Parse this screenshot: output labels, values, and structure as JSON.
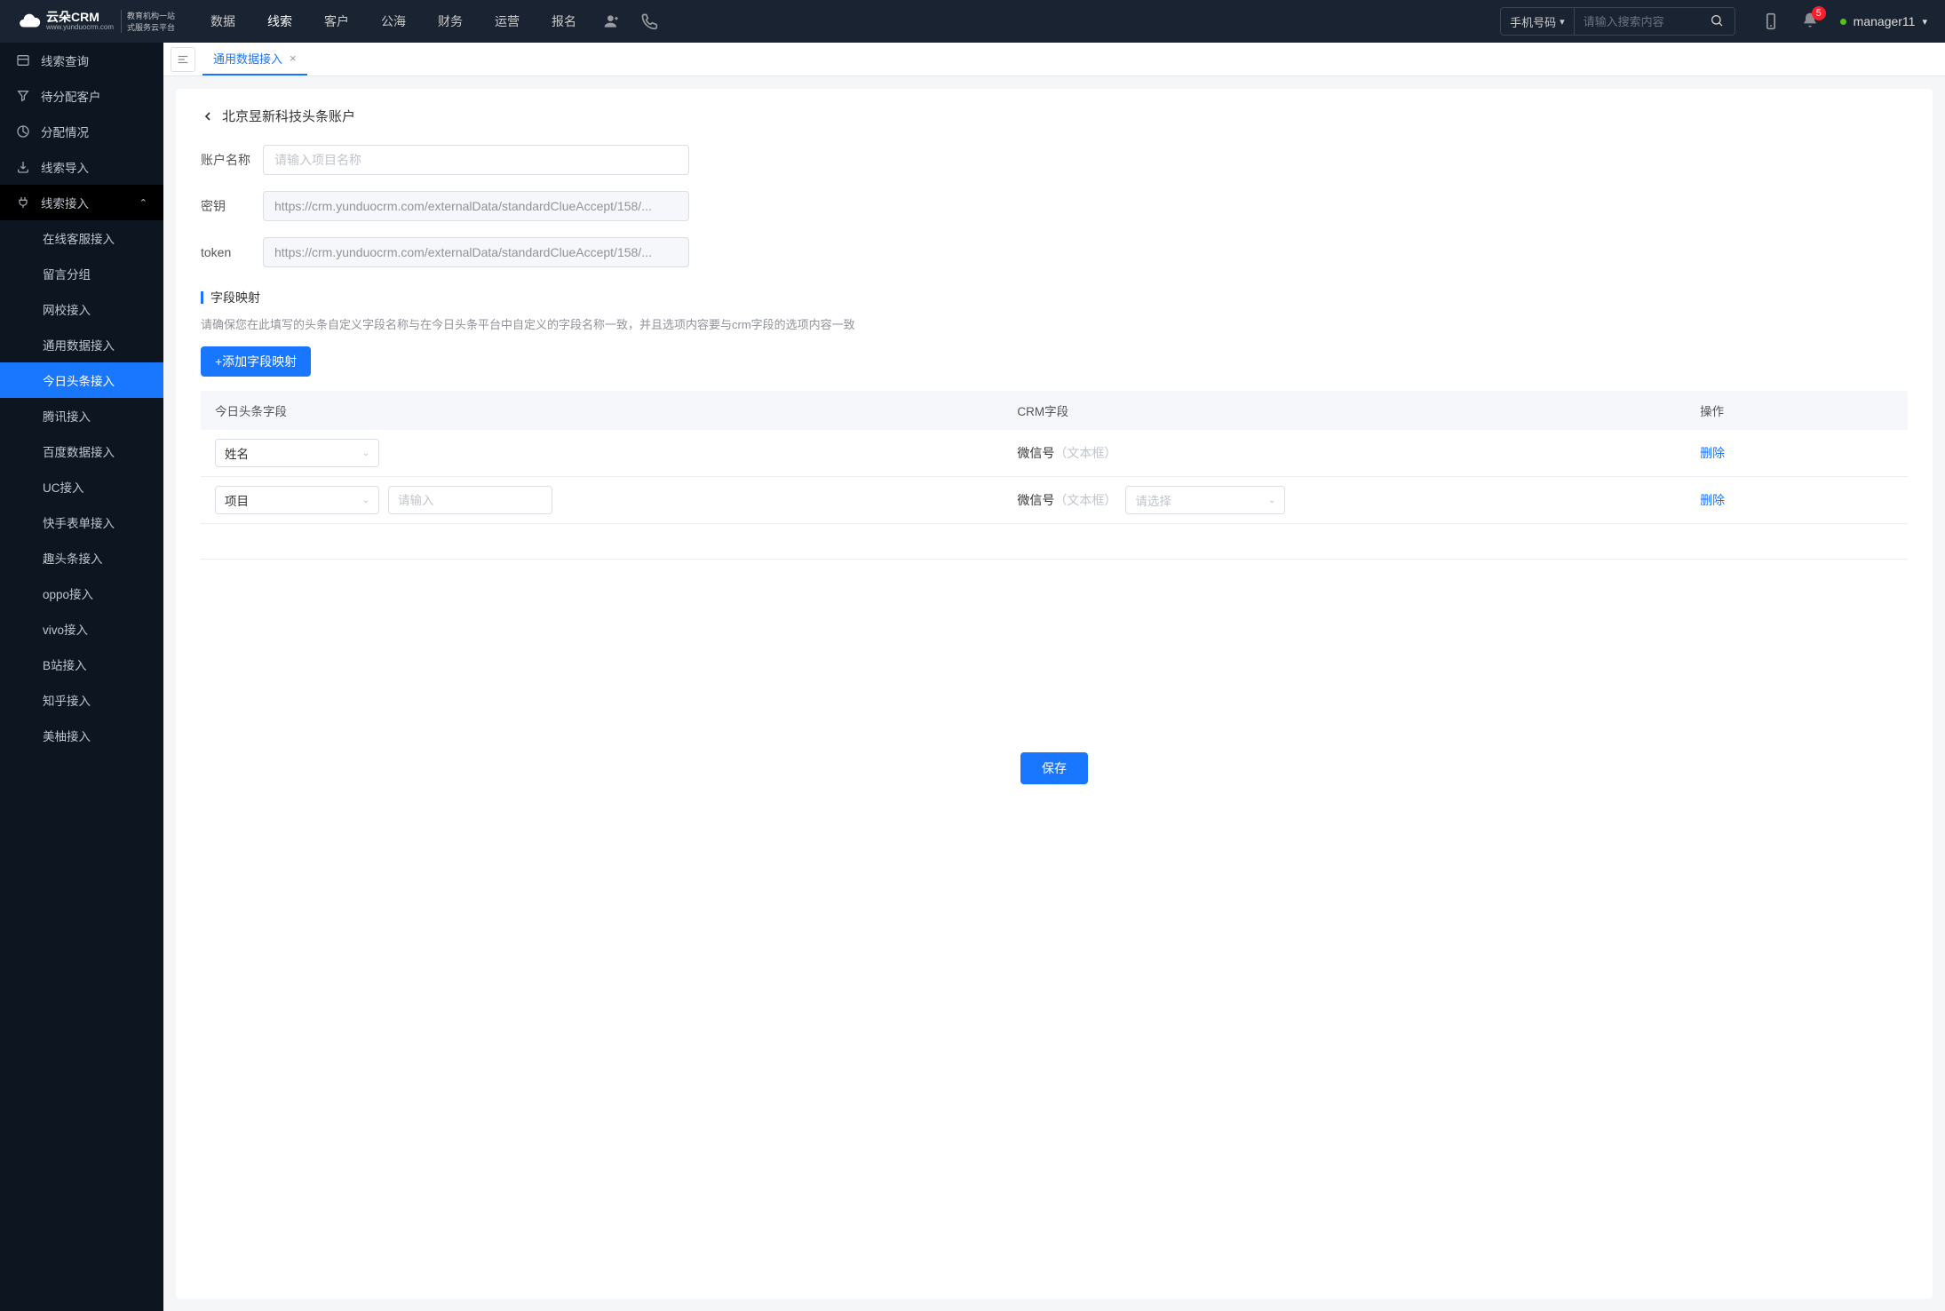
{
  "brand": {
    "name": "云朵CRM",
    "sub1": "教育机构一站",
    "sub2": "式服务云平台",
    "url": "www.yunduocrm.com"
  },
  "nav": {
    "items": [
      "数据",
      "线索",
      "客户",
      "公海",
      "财务",
      "运营",
      "报名"
    ],
    "active_index": 1
  },
  "search": {
    "type": "手机号码",
    "placeholder": "请输入搜索内容"
  },
  "notif_count": "5",
  "user": {
    "name": "manager11"
  },
  "sidebar": {
    "items": [
      {
        "label": "线索查询",
        "icon": "list"
      },
      {
        "label": "待分配客户",
        "icon": "filter"
      },
      {
        "label": "分配情况",
        "icon": "stats"
      },
      {
        "label": "线索导入",
        "icon": "import"
      }
    ],
    "group": {
      "label": "线索接入",
      "expanded": true
    },
    "subs": [
      "在线客服接入",
      "留言分组",
      "网校接入",
      "通用数据接入",
      "今日头条接入",
      "腾讯接入",
      "百度数据接入",
      "UC接入",
      "快手表单接入",
      "趣头条接入",
      "oppo接入",
      "vivo接入",
      "B站接入",
      "知乎接入",
      "美柚接入"
    ],
    "sub_active_index": 4
  },
  "tabs": {
    "items": [
      {
        "label": "通用数据接入"
      }
    ],
    "active_index": 0
  },
  "page": {
    "title": "北京昱新科技头条账户",
    "form": {
      "account_label": "账户名称",
      "account_placeholder": "请输入项目名称",
      "secret_label": "密钥",
      "secret_value": "https://crm.yunduocrm.com/externalData/standardClueAccept/158/...",
      "token_label": "token",
      "token_value": "https://crm.yunduocrm.com/externalData/standardClueAccept/158/..."
    },
    "mapping": {
      "title": "字段映射",
      "desc": "请确保您在此填写的头条自定义字段名称与在今日头条平台中自定义的字段名称一致，并且选项内容要与crm字段的选项内容一致",
      "add_label": "+添加字段映射",
      "cols": {
        "a": "今日头条字段",
        "b": "CRM字段",
        "c": "操作"
      },
      "rows": [
        {
          "field": "姓名",
          "extra_input": false,
          "crm_label": "微信号",
          "crm_hint": "（文本框）",
          "crm_select": null
        },
        {
          "field": "项目",
          "extra_input": true,
          "extra_placeholder": "请输入",
          "crm_label": "微信号",
          "crm_hint": "（文本框）",
          "crm_select": "请选择"
        }
      ],
      "delete_label": "删除"
    },
    "save_label": "保存"
  }
}
